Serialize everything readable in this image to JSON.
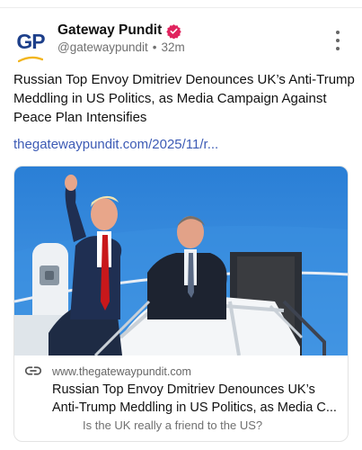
{
  "author": {
    "name": "Gateway Pundit",
    "handle": "@gatewaypundit",
    "separator": "•",
    "time": "32m",
    "avatar_text": "GP",
    "verified_icon": "verified-badge-icon",
    "badge_color": "#e0245e"
  },
  "post": {
    "text": "Russian Top Envoy Dmitriev Denounces UK’s Anti-Trump Meddling in US Politics, as Media Campaign Against Peace Plan Intensifies",
    "link": "thegatewaypundit.com/2025/11/r..."
  },
  "card": {
    "domain": "www.thegatewaypundit.com",
    "title_line1": "Russian Top Envoy Dmitriev Denounces UK’s",
    "title_line2": "Anti-Trump Meddling in US Politics, as Media C...",
    "description": "Is the UK really a friend to the US?",
    "link_icon": "link-icon"
  },
  "colors": {
    "link": "#3d5bb5",
    "brand_blue": "#1d3f8a",
    "brand_yellow": "#f2b51d"
  }
}
